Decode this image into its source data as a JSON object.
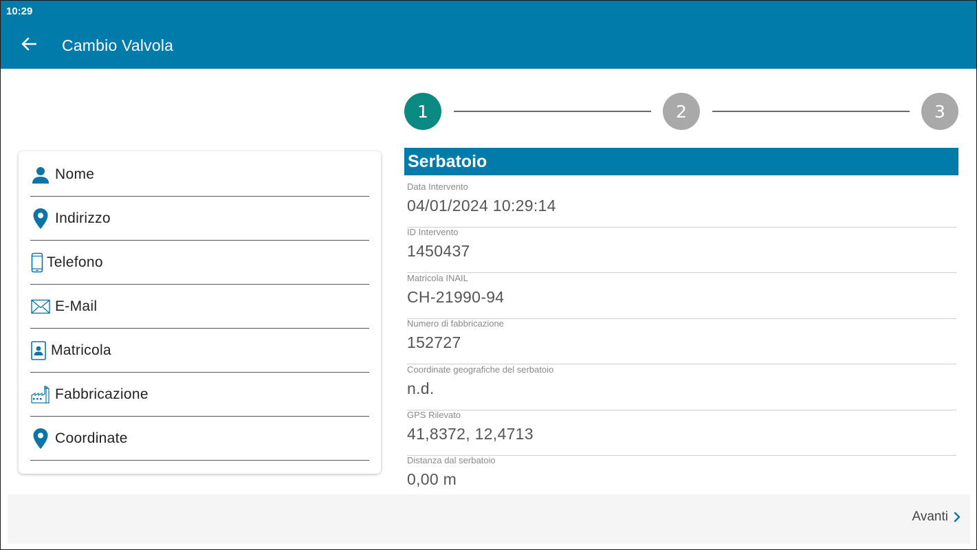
{
  "status_bar": {
    "time": "10:29"
  },
  "app_bar": {
    "title": "Cambio Valvola",
    "back_icon": "arrow-left-icon"
  },
  "colors": {
    "primary": "#007baa",
    "step_active": "#0a8a82",
    "step_inactive": "#a9a9a9"
  },
  "stepper": {
    "steps": [
      {
        "label": "1",
        "state": "active"
      },
      {
        "label": "2",
        "state": "inactive"
      },
      {
        "label": "3",
        "state": "inactive"
      }
    ]
  },
  "sidebar": {
    "items": [
      {
        "label": "Nome",
        "icon": "person-icon"
      },
      {
        "label": "Indirizzo",
        "icon": "location-pin-icon"
      },
      {
        "label": "Telefono",
        "icon": "phone-icon"
      },
      {
        "label": "E-Mail",
        "icon": "envelope-icon"
      },
      {
        "label": "Matricola",
        "icon": "id-badge-icon"
      },
      {
        "label": "Fabbricazione",
        "icon": "factory-icon"
      },
      {
        "label": "Coordinate",
        "icon": "location-pin-icon"
      }
    ]
  },
  "section": {
    "title": "Serbatoio",
    "fields": [
      {
        "label": "Data Intervento",
        "value": "04/01/2024 10:29:14"
      },
      {
        "label": "ID Intervento",
        "value": "1450437"
      },
      {
        "label": "Matricola INAIL",
        "value": "CH-21990-94"
      },
      {
        "label": "Numero di fabbricazione",
        "value": "152727"
      },
      {
        "label": "Coordinate geografiche del serbatoio",
        "value": "n.d."
      },
      {
        "label": "GPS Rilevato",
        "value": "41,8372, 12,4713"
      },
      {
        "label": "Distanza dal serbatoio",
        "value": "0,00 m"
      }
    ]
  },
  "footer": {
    "next_label": "Avanti",
    "next_icon": "chevron-right-icon"
  }
}
